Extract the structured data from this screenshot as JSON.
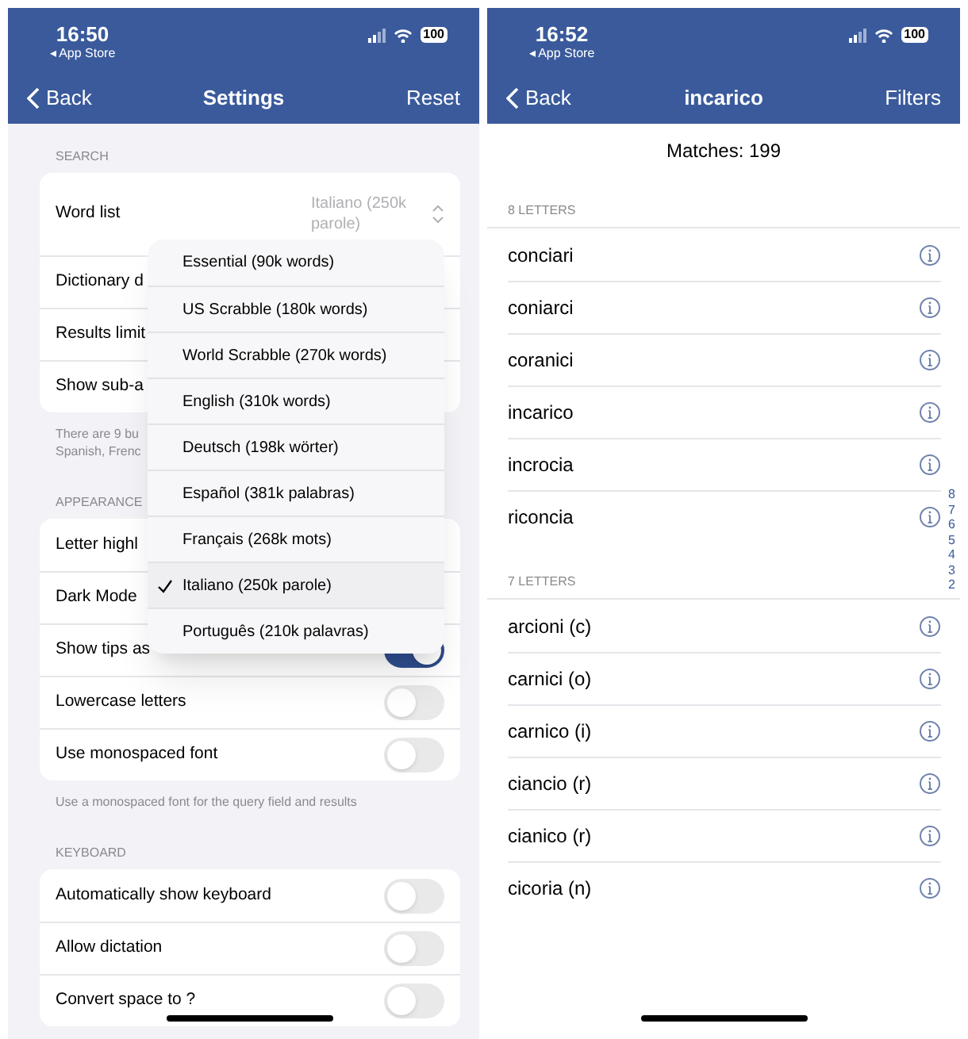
{
  "settings_screen": {
    "status_bar": {
      "time": "16:50",
      "back_app": "◂ App Store",
      "battery": "100"
    },
    "nav": {
      "back": "Back",
      "title": "Settings",
      "action": "Reset"
    },
    "sections": [
      {
        "header": "SEARCH",
        "rows": [
          {
            "kind": "picker",
            "label": "Word list",
            "value": "Italiano (250k parole)"
          },
          {
            "kind": "plain",
            "label": "Dictionary d"
          },
          {
            "kind": "plain",
            "label": "Results limit"
          },
          {
            "kind": "plain",
            "label": "Show sub-a"
          }
        ],
        "footer": [
          "There are 9 bu",
          "Spanish, Frenc"
        ]
      },
      {
        "header": "APPEARANCE",
        "rows": [
          {
            "kind": "plain",
            "label": "Letter highl"
          },
          {
            "kind": "plain",
            "label": "Dark Mode"
          },
          {
            "kind": "toggle",
            "label": "Show tips as",
            "on": true
          },
          {
            "kind": "toggle",
            "label": "Lowercase letters",
            "on": false
          },
          {
            "kind": "toggle",
            "label": "Use monospaced font",
            "on": false
          }
        ],
        "footer": [
          "Use a monospaced font for the query field and results"
        ]
      },
      {
        "header": "KEYBOARD",
        "rows": [
          {
            "kind": "toggle",
            "label": "Automatically show keyboard",
            "on": false
          },
          {
            "kind": "toggle",
            "label": "Allow dictation",
            "on": false
          },
          {
            "kind": "toggle",
            "label": "Convert space to ?",
            "on": false
          }
        ]
      }
    ],
    "word_list_menu": [
      {
        "label": "Essential (90k words)",
        "selected": false
      },
      {
        "label": "US Scrabble (180k words)",
        "selected": false
      },
      {
        "label": "World Scrabble (270k words)",
        "selected": false
      },
      {
        "label": "English (310k words)",
        "selected": false
      },
      {
        "label": "Deutsch (198k wörter)",
        "selected": false
      },
      {
        "label": "Español (381k palabras)",
        "selected": false
      },
      {
        "label": "Français (268k mots)",
        "selected": false
      },
      {
        "label": "Italiano (250k parole)",
        "selected": true
      },
      {
        "label": "Português (210k palavras)",
        "selected": false
      }
    ]
  },
  "results_screen": {
    "status_bar": {
      "time": "16:52",
      "back_app": "◂ App Store",
      "battery": "100"
    },
    "nav": {
      "back": "Back",
      "title": "incarico",
      "action": "Filters"
    },
    "matches": "Matches: 199",
    "groups": [
      {
        "header": "8 LETTERS",
        "words": [
          "conciari",
          "coniarci",
          "coranici",
          "incarico",
          "incrocia",
          "riconcia"
        ]
      },
      {
        "header": "7 LETTERS",
        "words": [
          "arcioni (c)",
          "carnici (o)",
          "carnico (i)",
          "ciancio (r)",
          "cianico (r)",
          "cicoria (n)"
        ]
      }
    ],
    "index": [
      "8",
      "7",
      "6",
      "5",
      "4",
      "3",
      "2"
    ]
  }
}
